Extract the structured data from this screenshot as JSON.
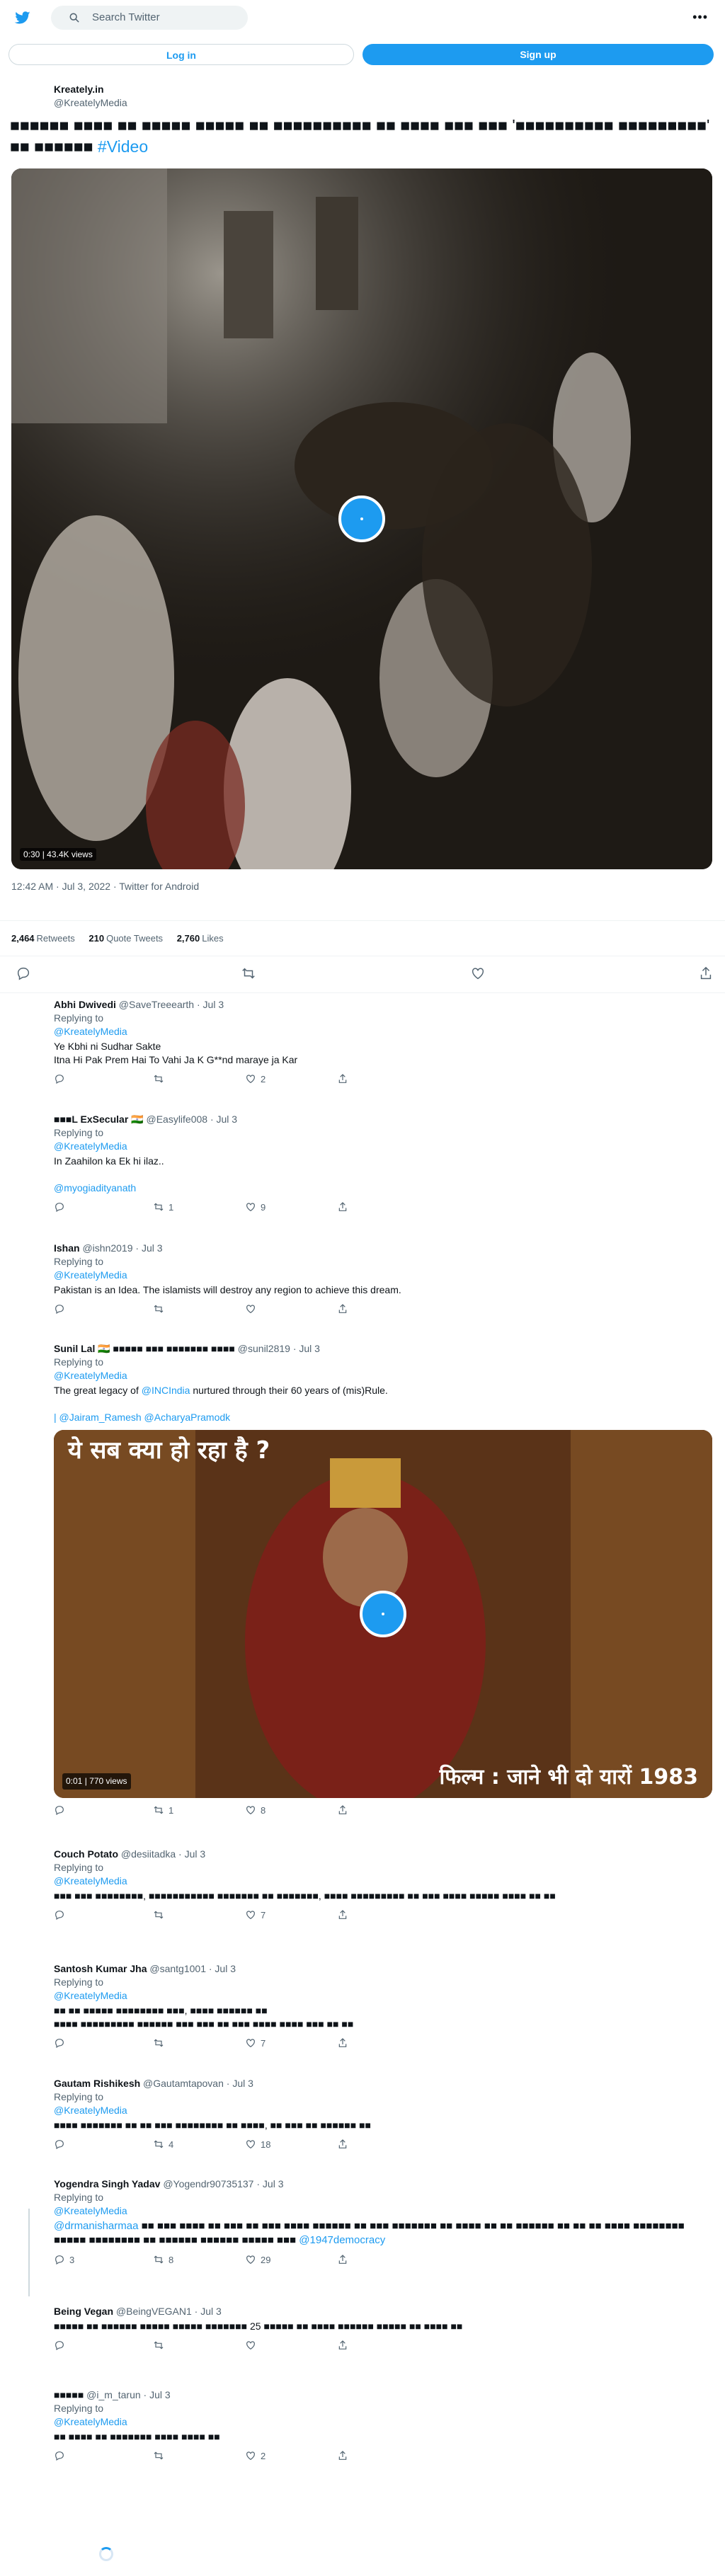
{
  "search": {
    "placeholder": "Search Twitter"
  },
  "buttons": {
    "login": "Log in",
    "signup": "Sign up"
  },
  "tweet": {
    "author_name": "Kreately.in",
    "author_handle": "@KreatelyMedia",
    "text": "■■■■■■ ■■■■ ■■ ■■■■■ ■■■■■ ■■ ■■■■■■■■■■ ■■ ■■■■ ■■■ ■■■ '■■■■■■■■■■ ■■■■■■■■■' ■■ ■■■■■■",
    "hashtag": "#Video",
    "video_views": "0:30 | 43.4K views",
    "timestamp": "12:42 AM · Jul 3, 2022 · Twitter for Android",
    "retweets": "2,464",
    "retweets_label": "Retweets",
    "quotes": "210",
    "quotes_label": "Quote Tweets",
    "likes": "2,760",
    "likes_label": "Likes"
  },
  "replies": [
    {
      "name": "Abhi Dwivedi",
      "handle": "@SaveTreeearth",
      "date": "· Jul 3",
      "replying": "Replying to",
      "to": "@KreatelyMedia",
      "lines": [
        "Ye Kbhi ni Sudhar Sakte",
        "Itna Hi Pak Prem Hai To Vahi Ja K G**nd maraye ja Kar"
      ],
      "retweets": "",
      "likes": "2"
    },
    {
      "name": "■■■L ExSecular 🇮🇳",
      "handle": "@Easylife008",
      "date": "· Jul 3",
      "replying": "Replying to",
      "to": "@KreatelyMedia",
      "lines": [
        "In Zaahilon ka Ek hi ilaz..",
        ""
      ],
      "mention": "@myogiadityanath",
      "retweets": "1",
      "likes": "9"
    },
    {
      "name": "Ishan",
      "handle": "@ishn2019",
      "date": "· Jul 3",
      "replying": "Replying to",
      "to": "@KreatelyMedia",
      "lines": [
        "Pakistan is an Idea.  The islamists will destroy any region to achieve this dream."
      ],
      "retweets": "",
      "likes": ""
    },
    {
      "name": "Sunil Lal 🇮🇳 ■■■■■ ■■■ ■■■■■■■ ■■■■",
      "handle": "@sunil2819",
      "date": "· Jul 3",
      "replying": "Replying to",
      "to": "@KreatelyMedia",
      "text_pre": "The great legacy of ",
      "text_link": "@INCIndia",
      "text_post": " nurtured through their 60 years of (mis)Rule.",
      "mentions": "| @Jairam_Ramesh @AcharyaPramodk",
      "media_text_top": "ये सब क्या हो रहा है ?",
      "media_text_bottom": "फिल्म : जाने भी दो यारों 1983",
      "media_views": "0:01 | 770 views",
      "retweets": "1",
      "likes": "8"
    },
    {
      "name": "Couch Potato",
      "handle": "@desiitadka",
      "date": "· Jul 3",
      "replying": "Replying to",
      "to": "@KreatelyMedia",
      "lines": [
        "■■■ ■■■ ■■■■■■■■, ■■■■■■■■■■■ ■■■■■■■ ■■ ■■■■■■■, ■■■■ ■■■■■■■■■ ■■ ■■■ ■■■■ ■■■■■ ■■■■ ■■ ■■"
      ],
      "retweets": "",
      "likes": "7"
    },
    {
      "name": "Santosh Kumar Jha",
      "handle": "@santg1001",
      "date": "· Jul 3",
      "replying": "Replying to",
      "to": "@KreatelyMedia",
      "lines": [
        "■■ ■■ ■■■■■ ■■■■■■■■ ■■■, ■■■■ ■■■■■■ ■■",
        "■■■■ ■■■■■■■■■ ■■■■■■ ■■■ ■■■ ■■ ■■■ ■■■■ ■■■■ ■■■ ■■ ■■"
      ],
      "retweets": "",
      "likes": "7"
    },
    {
      "name": "Gautam Rishikesh",
      "handle": "@Gautamtapovan",
      "date": "· Jul 3",
      "replying": "Replying to",
      "to": "@KreatelyMedia",
      "lines": [
        "■■■■ ■■■■■■■ ■■ ■■ ■■■ ■■■■■■■■ ■■ ■■■■, ■■ ■■■ ■■ ■■■■■■ ■■"
      ],
      "retweets": "4",
      "likes": "18"
    },
    {
      "name": "Yogendra Singh Yadav",
      "handle": "@Yogendr90735137",
      "date": "· Jul 3",
      "replying": "Replying to",
      "to": "@KreatelyMedia",
      "text_link": "@drmanisharmaa",
      "text_post": " ■■ ■■■ ■■■■ ■■ ■■■ ■■ ■■■ ■■■■ ■■■■■■ ■■ ■■■ ■■■■■■■ ■■ ■■■■ ■■ ■■ ■■■■■■ ■■ ■■ ■■ ■■■■ ■■■■■■■■ ■■■■■ ■■■■■■■■ ■■ ■■■■■■ ■■■■■■ ■■■■■ ■■■ ",
      "text_link2": "@1947democracy",
      "retweets": "8",
      "likes": "29",
      "replies": "3"
    },
    {
      "name": "Being Vegan",
      "handle": "@BeingVEGAN1",
      "date": "· Jul 3",
      "lines": [
        "■■■■■ ■■ ■■■■■■ ■■■■■ ■■■■■ ■■■■■■■ 25 ■■■■■ ■■ ■■■■ ■■■■■■ ■■■■■ ■■ ■■■■ ■■"
      ],
      "retweets": "",
      "likes": ""
    },
    {
      "name": "■■■■■",
      "handle": "@i_m_tarun",
      "date": "· Jul 3",
      "replying": "Replying to",
      "to": "@KreatelyMedia",
      "lines": [
        "■■ ■■■■ ■■ ■■■■■■■ ■■■■ ■■■■ ■■"
      ],
      "retweets": "",
      "likes": "2"
    }
  ]
}
